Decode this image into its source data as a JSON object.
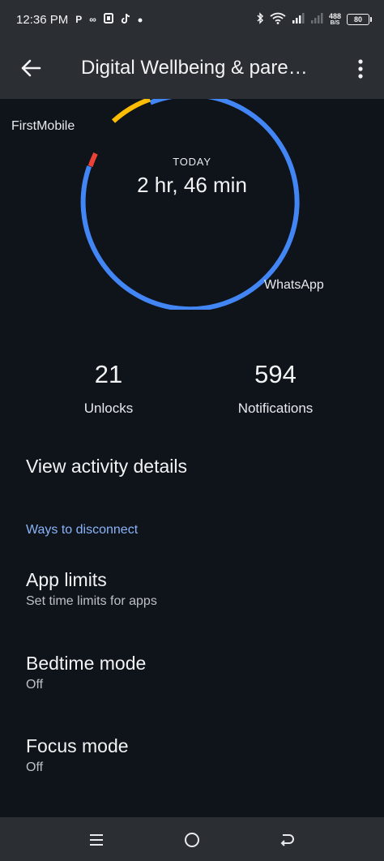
{
  "status_bar": {
    "time": "12:36 PM",
    "notification_icons": [
      "parking-icon",
      "infinity-icon",
      "office-icon",
      "tiktok-icon",
      "dot-icon"
    ],
    "net_speed_value": "488",
    "net_speed_unit": "B/S",
    "battery": "80"
  },
  "app_bar": {
    "title": "Digital Wellbeing & pare…",
    "back_icon": "arrow-left-icon",
    "overflow_icon": "more-vert-icon"
  },
  "usage_ring": {
    "today_label": "TODAY",
    "total_time": "2 hr, 46 min",
    "labels": {
      "first_mobile": "FirstMobile",
      "whatsapp": "WhatsApp"
    },
    "colors": {
      "blue": "#4285f4",
      "red": "#ea4335",
      "yellow": "#fbbc04"
    }
  },
  "stats": {
    "unlocks_value": "21",
    "unlocks_label": "Unlocks",
    "notifications_value": "594",
    "notifications_label": "Notifications"
  },
  "view_activity": "View activity details",
  "ways_to_disconnect": {
    "header": "Ways to disconnect",
    "items": [
      {
        "title": "App limits",
        "subtitle": "Set time limits for apps"
      },
      {
        "title": "Bedtime mode",
        "subtitle": "Off"
      },
      {
        "title": "Focus mode",
        "subtitle": "Off"
      }
    ]
  },
  "nav_bar": {
    "icons": [
      "menu-icon",
      "home-circle-icon",
      "back-icon"
    ]
  },
  "colors": {
    "background": "#0f131a",
    "bar": "#2b2e33",
    "accent": "#8ab4f8"
  }
}
